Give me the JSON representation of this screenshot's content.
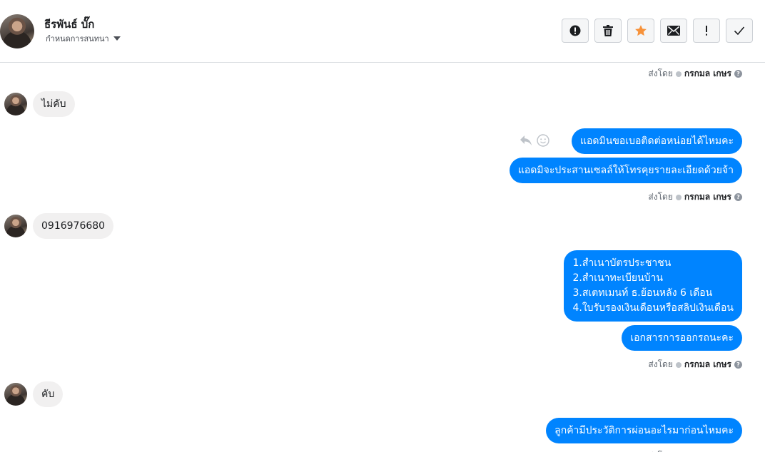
{
  "header": {
    "contact_name": "ธีรพันธ์ บั๊ก",
    "assign_label": "กำหนดการสนทนา"
  },
  "toolbar": {
    "buttons": [
      "spam",
      "delete",
      "star",
      "mark-unread",
      "follow-up",
      "done"
    ],
    "star_color": "#f7923a"
  },
  "thread": {
    "sent_by_prefix": "ส่งโดย",
    "sender_name": "กรกมล เกษร",
    "messages": [
      {
        "direction": "incoming",
        "text": "ไม่คับ"
      },
      {
        "direction": "outgoing",
        "text": "แอดมินขอเบอติดต่อหน่อยได้ไหมคะ"
      },
      {
        "direction": "outgoing",
        "text": "แอดมิจะประสานเซลล์ให้โทรคุยรายละเอียดด้วยจ้า"
      },
      {
        "direction": "incoming",
        "text": "0916976680"
      },
      {
        "direction": "outgoing",
        "lines": [
          "1.สำเนาบัตรประชาชน",
          "2.สำเนาทะเบียนบ้าน",
          "3.สเตทเมนท์ ธ.ย้อนหลัง 6 เดือน",
          "4.ใบรับรองเงินเดือนหรือสลิปเงินเดือน"
        ]
      },
      {
        "direction": "outgoing",
        "text": "เอกสารการออกรถนะคะ"
      },
      {
        "direction": "incoming",
        "text": "คับ"
      },
      {
        "direction": "outgoing",
        "text": "ลูกค้ามีประวัติการผ่อนอะไรมาก่อนไหมคะ"
      }
    ]
  },
  "colors": {
    "outgoing_bubble": "#0084ff",
    "incoming_bubble": "#f1f0f0"
  }
}
